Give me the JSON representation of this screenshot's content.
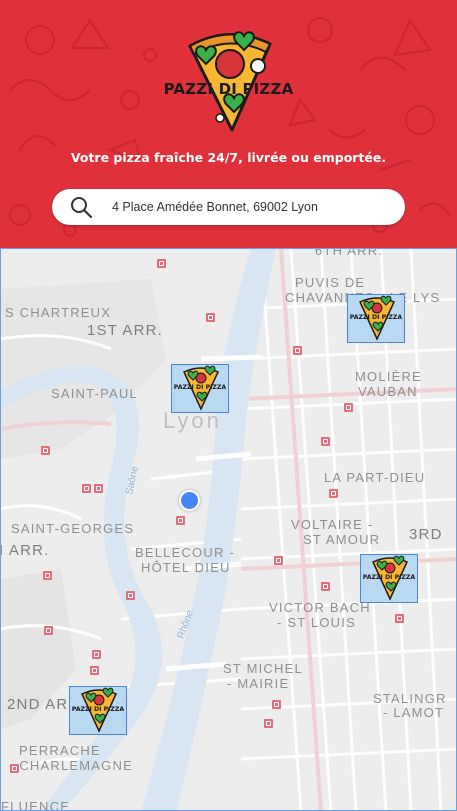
{
  "header": {
    "brand_name": "PAZZI DI PIZZA",
    "tagline": "Votre pizza fraîche 24/7, livrée ou emportée.",
    "background_color": "#e0313a"
  },
  "search": {
    "value": "4 Place Amédée Bonnet, 69002 Lyon",
    "icon": "search-icon"
  },
  "map": {
    "city_label": "Lyon",
    "district_labels": {
      "arr_6": "6TH ARR.",
      "chartreux": "S CHARTREUX",
      "arr_1": "1ST ARR.",
      "puvis_1": "PUVIS DE",
      "puvis_2": "CHAVANNES - LE LYS",
      "saint_paul": "SAINT-PAUL",
      "moliere_1": "MOLIÈRE",
      "moliere_2": "VAUBAN",
      "part_dieu": "LA PART-DIEU",
      "voltaire_1": "VOLTAIRE -",
      "voltaire_2": "ST AMOUR",
      "arr_3": "3RD",
      "saint_georges": "SAINT-GEORGES",
      "arr_5": "I ARR.",
      "bellecour_1": "BELLECOUR -",
      "bellecour_2": "HÔTEL DIEU",
      "victor_1": "VICTOR BACH",
      "victor_2": "- ST LOUIS",
      "michel_1": "ST MICHEL",
      "michel_2": "- MAIRIE",
      "arr_2": "2ND AR",
      "stalingrad_1": "STALINGR",
      "stalingrad_2": "- LAMOT",
      "perrache_1": "PERRACHE",
      "perrache_2": "- CHARLEMAGNE",
      "confluence": "FLUENCE"
    },
    "river_labels": {
      "saone": "Saône",
      "rhone": "Rhône"
    },
    "user_location_color": "#4386f4",
    "restaurant_markers": [
      {
        "label": "PAZZI DI PIZZA"
      },
      {
        "label": "PAZZI DI PIZZA"
      },
      {
        "label": "PAZZI DI PIZZA"
      },
      {
        "label": "PAZZI DI PIZZA"
      }
    ]
  }
}
